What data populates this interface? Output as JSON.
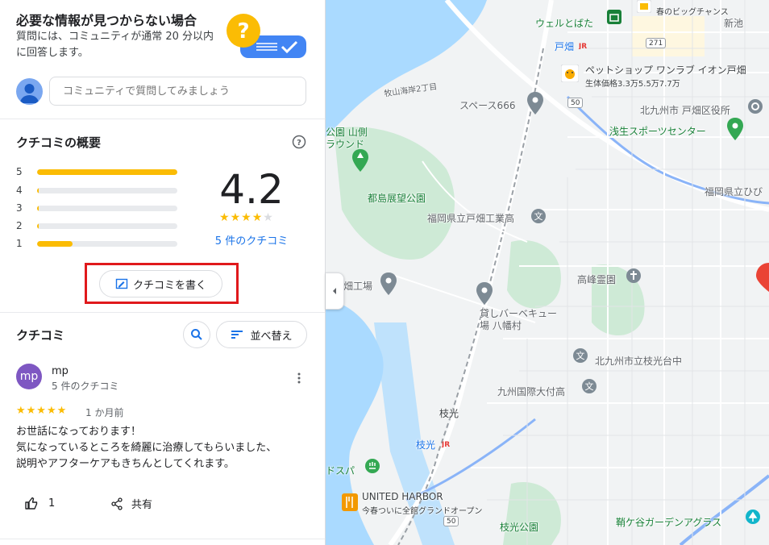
{
  "qa": {
    "title": "必要な情報が見つからない場合",
    "description": "質問には、コミュニティが通常 20 分以内に回答します。",
    "input_placeholder": "コミュニティで質問してみましょう"
  },
  "overview": {
    "title": "クチコミの概要",
    "rating": "4.2",
    "rating_value": 4.2,
    "review_count_link": "5 件のクチコミ",
    "distribution": [
      {
        "label": "5",
        "fraction": 1.0
      },
      {
        "label": "4",
        "fraction": 0.01
      },
      {
        "label": "3",
        "fraction": 0.01
      },
      {
        "label": "2",
        "fraction": 0.01
      },
      {
        "label": "1",
        "fraction": 0.25
      }
    ],
    "write_button": "クチコミを書く"
  },
  "reviews": {
    "title": "クチコミ",
    "sort_label": "並べ替え",
    "items": [
      {
        "avatar_text": "mp",
        "name": "mp",
        "count": "5 件のクチコミ",
        "stars": "★★★★★",
        "time": "1 か月前",
        "text_lines": [
          "お世話になっております！",
          "気になっているところを綺麗に治療してもらいました、",
          "説明やアフターケアもきちんとしてくれます。"
        ],
        "likes": "1",
        "share_label": "共有"
      }
    ]
  },
  "map": {
    "labels": {
      "wel_tobata": "ウェルとばた",
      "tobata_station": "戸畑",
      "pet_shop": "ペットショップ ワンラブ イオン戸畑",
      "pet_shop_sub": "生体価格3.3万5.5万7.7万",
      "space666": "スペース666",
      "kitakyushu_ward": "北九州市 戸畑区役所",
      "asao_sports": "浅生スポーツセンター",
      "kokoen_yama": "公園 山側",
      "ground": "ラウンド",
      "tojima_park": "都島展望公園",
      "tobata_tech": "福岡県立戸畑工業高",
      "fukuoka_high": "福岡県立ひび",
      "factory": "畑工場",
      "kouho_reien": "高峰霊園",
      "bbq": "貸しバーベキュー",
      "bbq2": "場 八幡村",
      "edamitsudai": "北九州市立枝光台中",
      "kyushu_intl": "九州国際大付高",
      "edamitsu_area": "枝光",
      "edamitsu_station": "枝光",
      "spa": "ドスパ",
      "united_harbor": "UNITED HARBOR",
      "united_harbor_sub": "今春ついに全館グランドオープン",
      "edamitsu_park": "枝光公園",
      "garden_aglass": "鞘ケ谷ガーデンアグラス",
      "shinike": "新池",
      "top_text": "春のビッグチャンス",
      "route_50": "50",
      "route_271": "271",
      "road_label": "牧山海岸2丁目"
    }
  },
  "colors": {
    "accent": "#1a73e8",
    "star": "#fbbc04",
    "highlight_box": "#e0191c",
    "water": "#aadaff",
    "park": "#c8e6c9"
  }
}
